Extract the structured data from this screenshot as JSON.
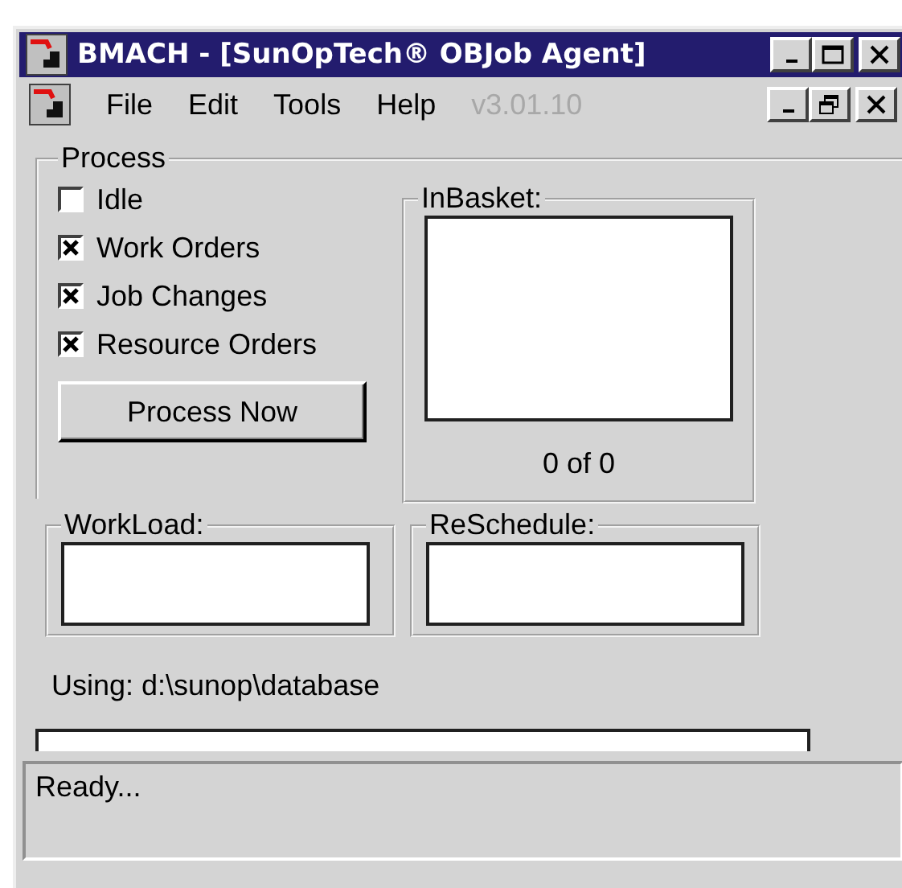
{
  "window": {
    "title": "BMACH - [SunOpTech® OBJob Agent]"
  },
  "menu": [
    {
      "label": "File",
      "disabled": false
    },
    {
      "label": "Edit",
      "disabled": false
    },
    {
      "label": "Tools",
      "disabled": false
    },
    {
      "label": "Help",
      "disabled": false
    },
    {
      "label": "v3.01.10",
      "disabled": true
    }
  ],
  "process": {
    "title": "Process",
    "options": [
      {
        "label": "Idle",
        "checked": false
      },
      {
        "label": "Work Orders",
        "checked": true
      },
      {
        "label": "Job Changes",
        "checked": true
      },
      {
        "label": "Resource Orders",
        "checked": true
      }
    ],
    "button": "Process Now"
  },
  "inbasket": {
    "title": "InBasket:",
    "count": "0 of 0"
  },
  "workload": {
    "title": "WorkLoad:"
  },
  "reschedule": {
    "title": "ReSchedule:"
  },
  "using": "Using: d:\\sunop\\database",
  "status_bar": "Ready..."
}
